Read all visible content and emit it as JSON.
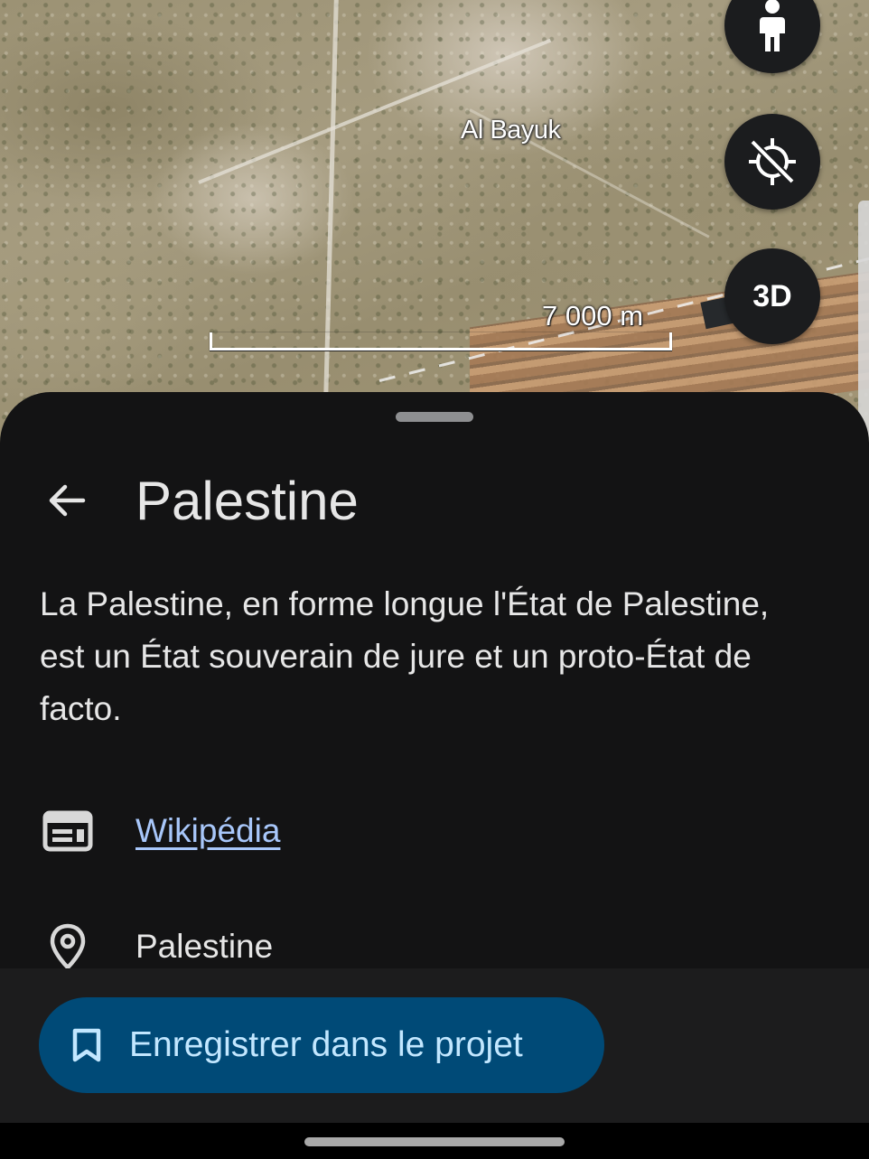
{
  "map": {
    "place_label": "Al Bayuk",
    "scale_label": "7 000 m",
    "buttons": {
      "street_view_icon": "person-icon",
      "location_icon": "location-disabled-icon",
      "three_d_label": "3D"
    }
  },
  "sheet": {
    "title": "Palestine",
    "description": "La Palestine, en forme longue l'État de Palestine, est un État souverain de jure et un proto-État de facto.",
    "wiki_link": "Wikipédia",
    "place_name": "Palestine"
  },
  "footer": {
    "save_label": "Enregistrer dans le projet"
  },
  "colors": {
    "sheet_bg": "#131314",
    "link": "#a8c7fa",
    "save_button_bg": "#004a77",
    "save_button_text": "#c2e7ff"
  }
}
